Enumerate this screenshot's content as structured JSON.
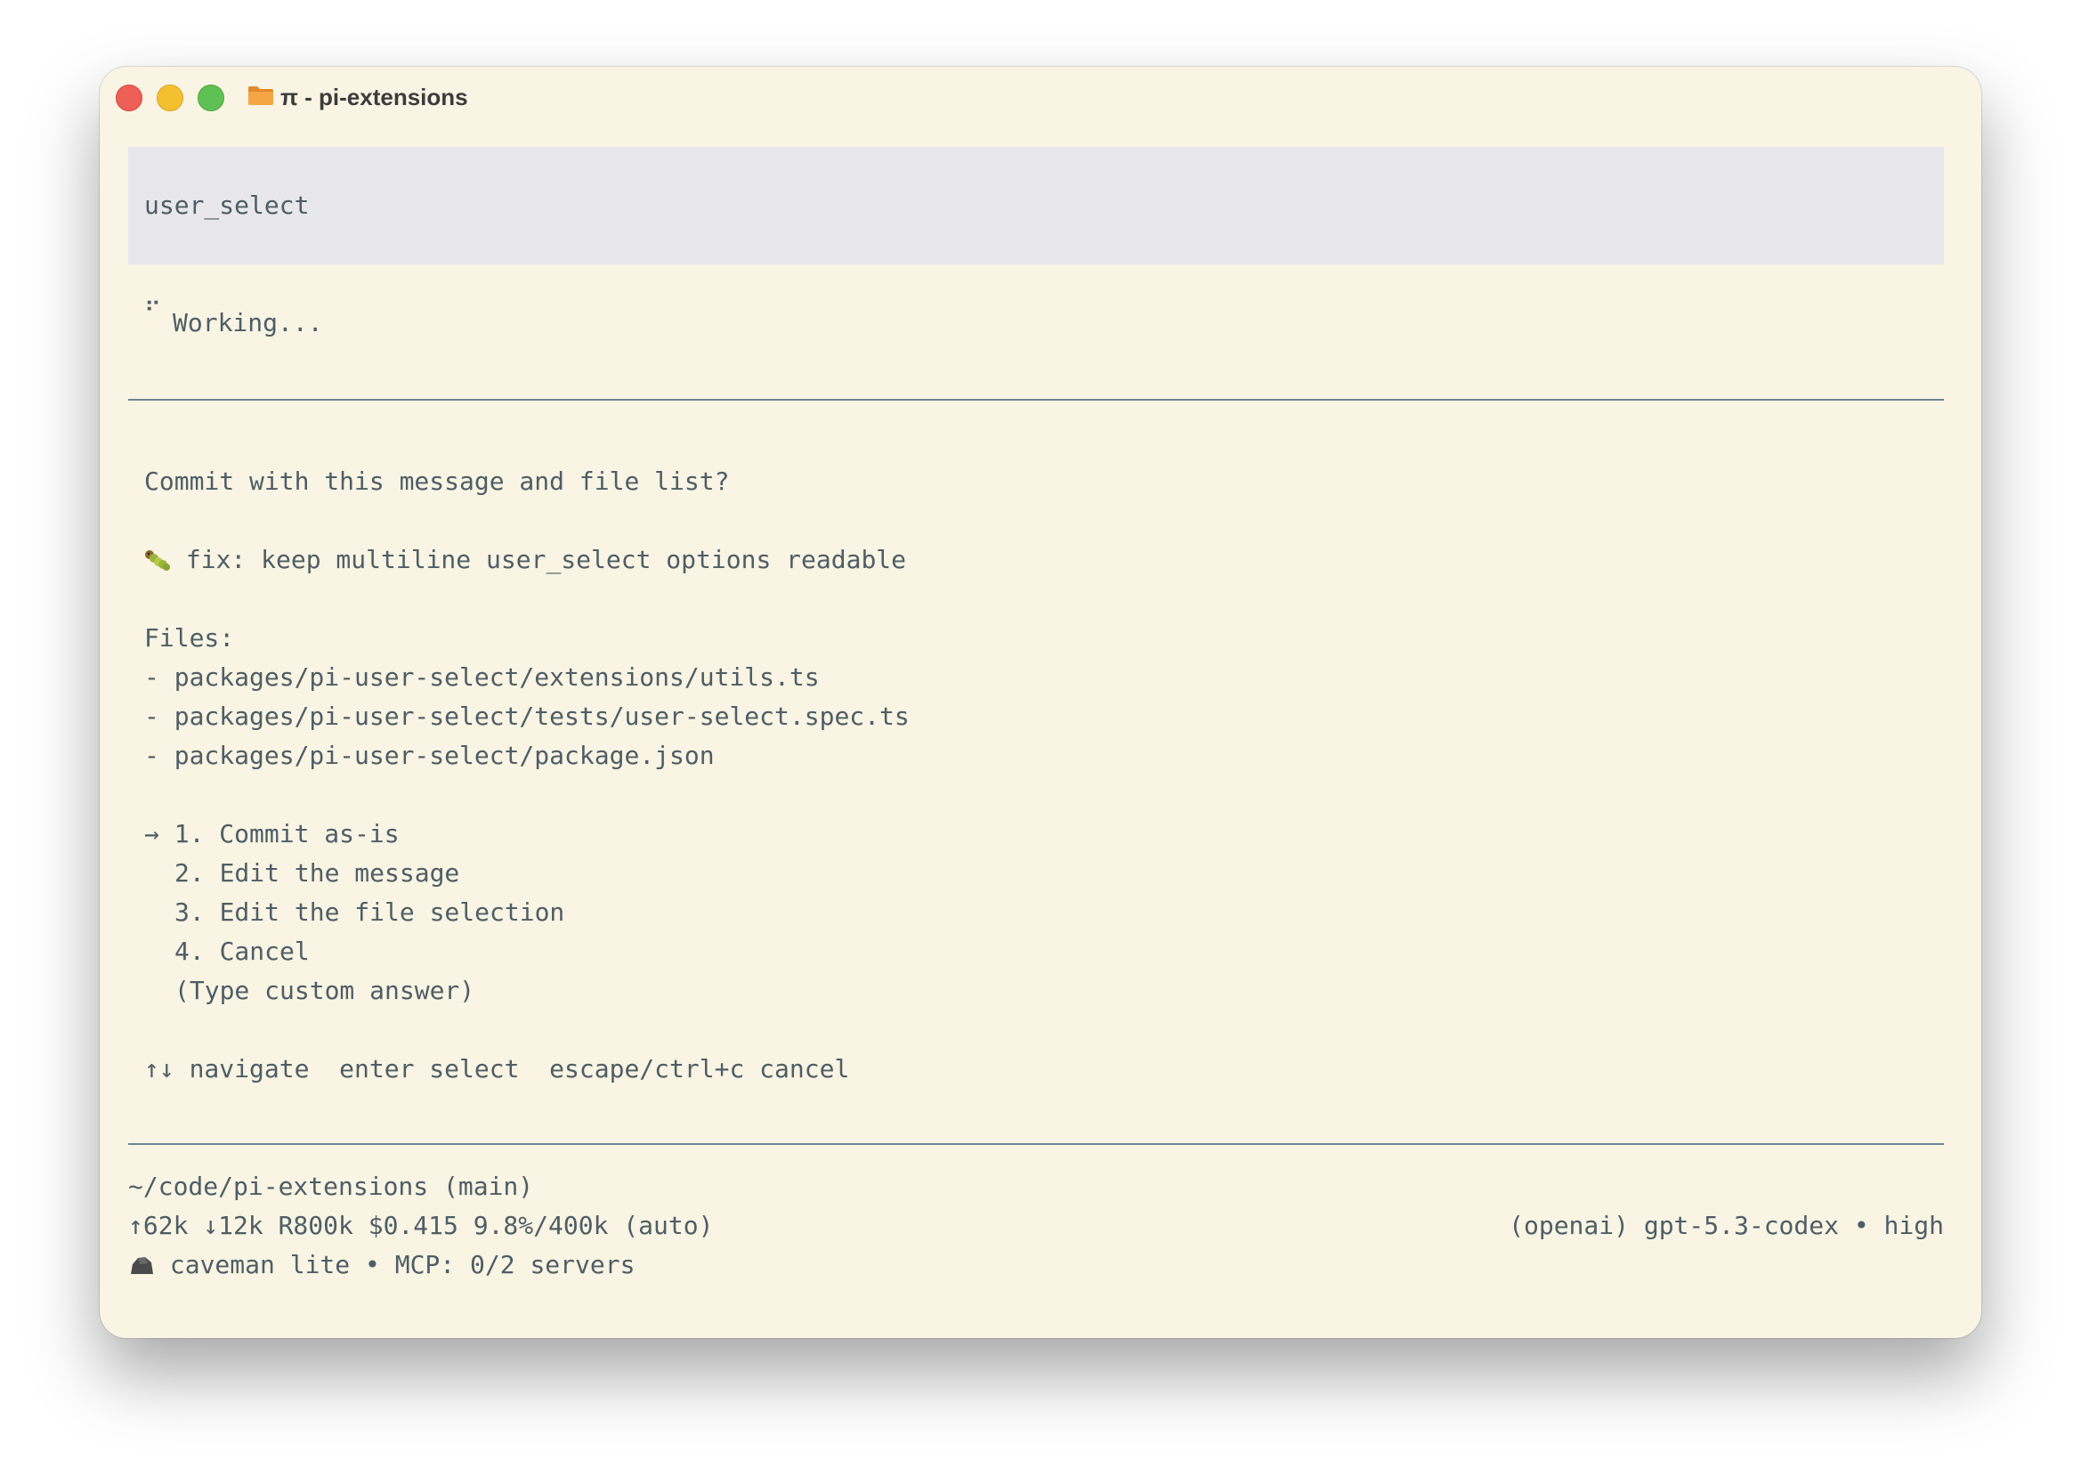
{
  "window": {
    "title": "π - pi-extensions"
  },
  "tool": {
    "name": "user_select"
  },
  "status": {
    "spinner": "⠋",
    "working": "Working..."
  },
  "prompt": {
    "question": "Commit with this message and file list?",
    "commit_message": "fix: keep multiline user_select options readable",
    "files_label": "Files:",
    "files": [
      "- packages/pi-user-select/extensions/utils.ts",
      "- packages/pi-user-select/tests/user-select.spec.ts",
      "- packages/pi-user-select/package.json"
    ],
    "selected_marker": "→",
    "options": [
      "1. Commit as-is",
      "2. Edit the message",
      "3. Edit the file selection",
      "4. Cancel",
      "(Type custom answer)"
    ],
    "hints": "↑↓ navigate  enter select  escape/ctrl+c cancel"
  },
  "footer": {
    "cwd": "~/code/pi-extensions (main)",
    "usage": "↑62k ↓12k R800k $0.415 9.8%/400k (auto)",
    "model": "(openai) gpt-5.3-codex • high",
    "extras": "caveman lite • MCP: 0/2 servers"
  },
  "colors": {
    "window_bg": "#f9f4e3",
    "tool_block_bg": "#e8e8ec",
    "text": "#4e5e66",
    "divider": "#6d8694"
  },
  "icons": [
    "folder-icon",
    "caterpillar-icon",
    "rock-icon"
  ]
}
